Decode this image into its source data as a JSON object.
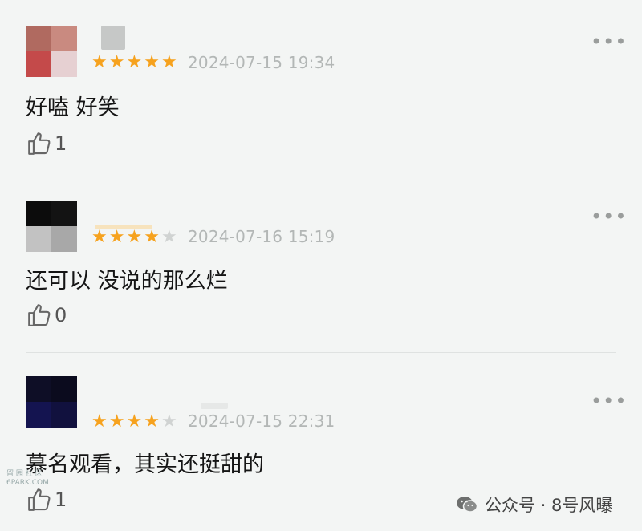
{
  "reviews": [
    {
      "date": "2024-07-15 19:34",
      "rating": 5,
      "content": "好嗑 好笑",
      "likes": "1",
      "avatar_colors": [
        "#b06a60",
        "#c98a80",
        "#c44a4a",
        "#e6d0d2"
      ]
    },
    {
      "date": "2024-07-16 15:19",
      "rating": 4,
      "content": "还可以 没说的那么烂",
      "likes": "0",
      "avatar_colors": [
        "#0c0c0c",
        "#131313",
        "#c2c2c2",
        "#a8a8a8"
      ]
    },
    {
      "date": "2024-07-15 22:31",
      "rating": 4,
      "content": "慕名观看，其实还挺甜的",
      "likes": "1",
      "avatar_colors": [
        "#0e0e26",
        "#0b0b1e",
        "#141450",
        "#11113e"
      ]
    }
  ],
  "more_label": "•••",
  "watermark": {
    "left_line1": "留 园 社 区",
    "left_line2": "6PARK.COM",
    "right_text": "公众号 · 8号风曝"
  },
  "colors": {
    "star_on": "#f6a21e",
    "star_off": "#d0d3d2",
    "date": "#b3b7b6"
  }
}
